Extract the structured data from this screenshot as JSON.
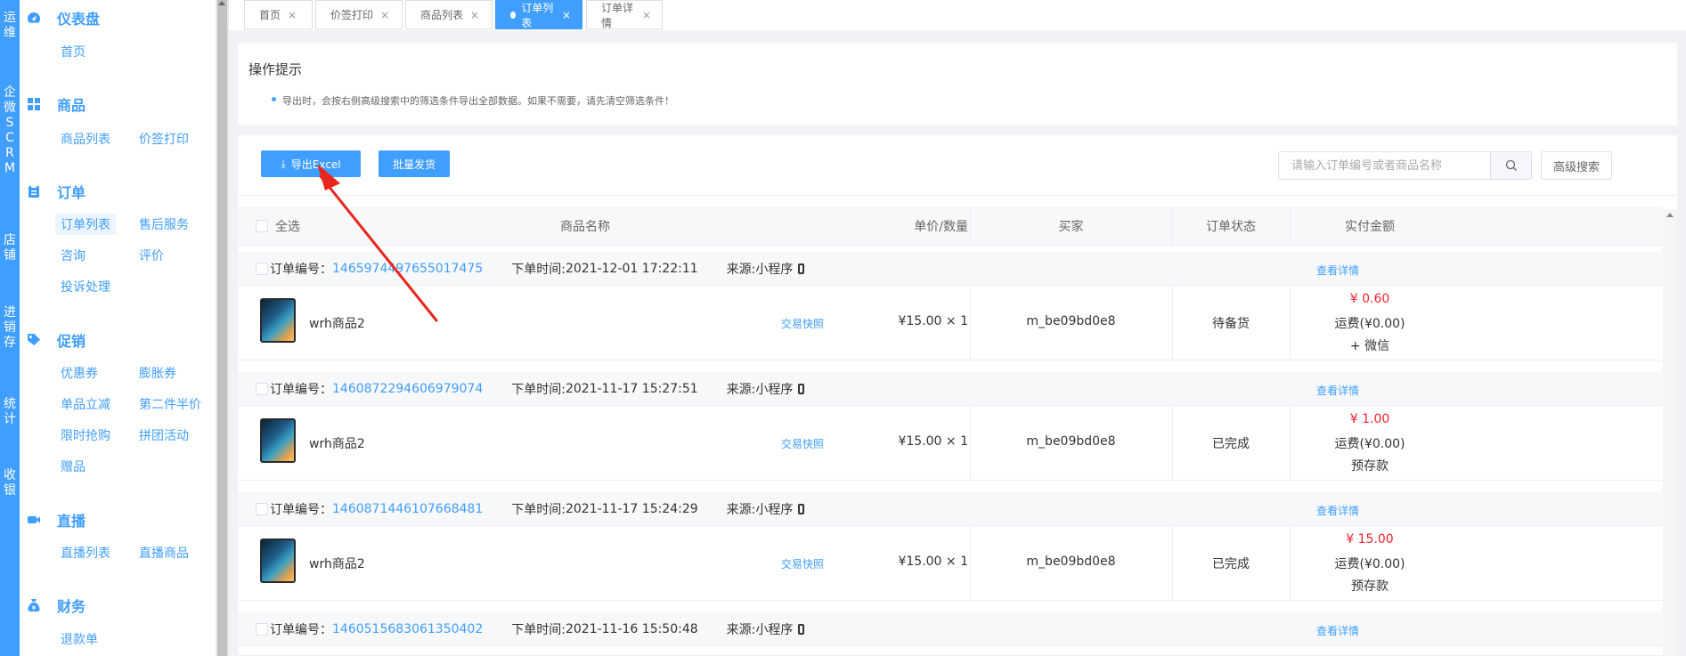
{
  "strip": {
    "items": [
      "运维",
      "企微SCRM",
      "店铺",
      "进销存",
      "统计",
      "收银"
    ]
  },
  "sidebar": {
    "groups": [
      {
        "title": "仪表盘",
        "icon": "dashboard-icon",
        "items": [
          "首页"
        ]
      },
      {
        "title": "商品",
        "icon": "grid-icon",
        "items": [
          "商品列表",
          "价签打印"
        ]
      },
      {
        "title": "订单",
        "icon": "clipboard-icon",
        "items": [
          "订单列表",
          "售后服务",
          "咨询",
          "评价",
          "投诉处理"
        ]
      },
      {
        "title": "促销",
        "icon": "tag-icon",
        "items": [
          "优惠券",
          "膨胀券",
          "单品立减",
          "第二件半价",
          "限时抢购",
          "拼团活动",
          "赠品"
        ]
      },
      {
        "title": "直播",
        "icon": "video-icon",
        "items": [
          "直播列表",
          "直播商品"
        ]
      },
      {
        "title": "财务",
        "icon": "money-bag-icon",
        "items": [
          "退款单"
        ]
      }
    ],
    "active_item": "订单列表"
  },
  "tabs": [
    {
      "label": "首页",
      "close": "×"
    },
    {
      "label": "价签打印",
      "close": "×"
    },
    {
      "label": "商品列表",
      "close": "×"
    },
    {
      "label": "订单列表",
      "close": "×"
    },
    {
      "label": "订单详情",
      "close": "×"
    }
  ],
  "tips": {
    "title": "操作提示",
    "items": [
      "导出时，会按右侧高级搜索中的筛选条件导出全部数据。如果不需要，请先清空筛选条件！"
    ]
  },
  "toolbar": {
    "export_label": "导出Excel",
    "export_icon": "download-icon",
    "batch_label": "批量发货",
    "search_placeholder": "请输入订单编号或者商品名称",
    "search_value": "",
    "search_icon": "search-icon",
    "advanced_label": "高级搜索"
  },
  "table": {
    "headers": {
      "select_all": "全选",
      "product_name": "商品名称",
      "price_qty": "单价/数量",
      "buyer": "买家",
      "status": "订单状态",
      "paid": "实付金额"
    },
    "labels": {
      "order_no": "订单编号：",
      "order_time": "下单时间: ",
      "source": "来源: ",
      "detail_link": "查看详情",
      "snapshot_link": "交易快照"
    },
    "orders": [
      {
        "order_no": "1465974497655017475",
        "time": "2021-12-01 17:22:11",
        "source": "小程序",
        "product": "wrh商品2",
        "price_qty": "¥15.00 × 1",
        "buyer": "m_be09bd0e8",
        "status": "待备货",
        "amount": "¥ 0.60",
        "shipping": "运费(¥0.00)",
        "pay_method": "+ 微信"
      },
      {
        "order_no": "1460872294606979074",
        "time": "2021-11-17 15:27:51",
        "source": "小程序",
        "product": "wrh商品2",
        "price_qty": "¥15.00 × 1",
        "buyer": "m_be09bd0e8",
        "status": "已完成",
        "amount": "¥ 1.00",
        "shipping": "运费(¥0.00)",
        "pay_method": "预存款"
      },
      {
        "order_no": "1460871446107668481",
        "time": "2021-11-17 15:24:29",
        "source": "小程序",
        "product": "wrh商品2",
        "price_qty": "¥15.00 × 1",
        "buyer": "m_be09bd0e8",
        "status": "已完成",
        "amount": "¥ 15.00",
        "shipping": "运费(¥0.00)",
        "pay_method": "预存款"
      },
      {
        "order_no": "1460515683061350402",
        "time": "2021-11-16 15:50:48",
        "source": "小程序"
      }
    ]
  },
  "colors": {
    "primary": "#409eff",
    "danger": "#f5222d",
    "annotation": "#e8261c"
  }
}
